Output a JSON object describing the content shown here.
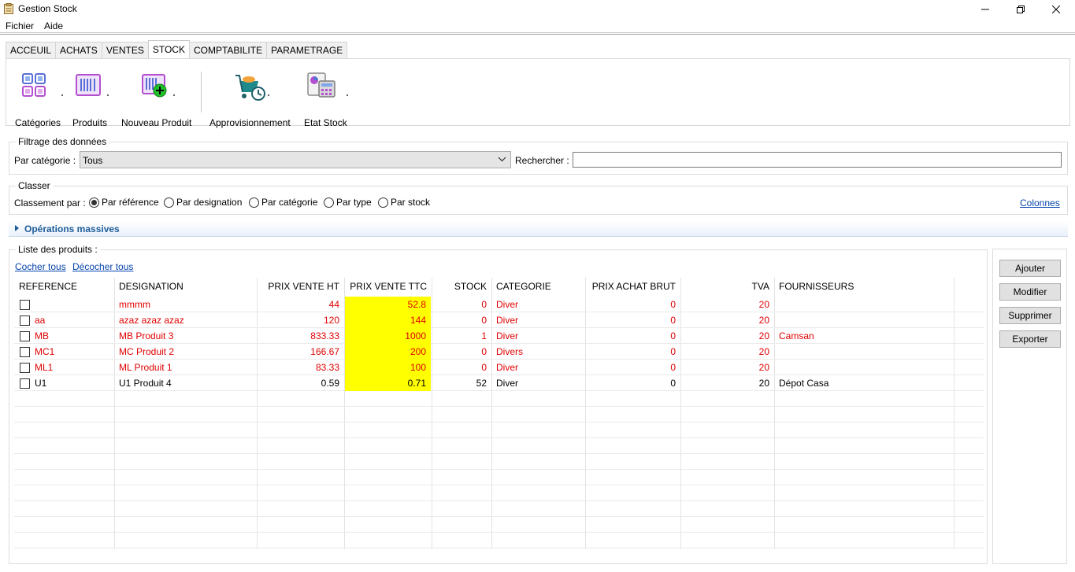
{
  "window": {
    "title": "Gestion Stock"
  },
  "menu": [
    "Fichier",
    "Aide"
  ],
  "tabs": [
    "ACCEUIL",
    "ACHATS",
    "VENTES",
    "STOCK",
    "COMPTABILITE",
    "PARAMETRAGE"
  ],
  "active_tab": "STOCK",
  "ribbon": {
    "categories": "Catégories",
    "produits": "Produits",
    "nouveau_produit": "Nouveau Produit",
    "approvisionnement": "Approvisionnement",
    "etat_stock": "Etat Stock"
  },
  "filter": {
    "group_title": "Filtrage des données",
    "category_label": "Par catégorie :",
    "category_value": "Tous",
    "search_label": "Rechercher :",
    "search_value": ""
  },
  "sort": {
    "group_title": "Classer",
    "label": "Classement par :",
    "options": [
      "Par référence",
      "Par designation",
      "Par catégorie",
      "Par type",
      "Par stock"
    ],
    "selected": "Par référence",
    "columns_link": "Colonnes"
  },
  "massive": {
    "label": "Opérations massives"
  },
  "list": {
    "group_title": "Liste des produits :",
    "check_all": "Cocher tous",
    "uncheck_all": "Décocher tous",
    "headers": [
      "REFERENCE",
      "DESIGNATION",
      "PRIX VENTE HT",
      "PRIX VENTE TTC",
      "STOCK",
      "CATEGORIE",
      "PRIX ACHAT BRUT",
      "TVA",
      "FOURNISSEURS"
    ],
    "rows": [
      {
        "ref": "",
        "designation": "mmmm",
        "pvht": "44",
        "pvttc": "52.8",
        "stock": "0",
        "categorie": "Diver",
        "achat": "0",
        "tva": "20",
        "fournisseur": "",
        "alert": true
      },
      {
        "ref": "aa",
        "designation": "azaz azaz azaz",
        "pvht": "120",
        "pvttc": "144",
        "stock": "0",
        "categorie": "Diver",
        "achat": "0",
        "tva": "20",
        "fournisseur": "",
        "alert": true
      },
      {
        "ref": "MB",
        "designation": "MB Produit 3",
        "pvht": "833.33",
        "pvttc": "1000",
        "stock": "1",
        "categorie": "Diver",
        "achat": "0",
        "tva": "20",
        "fournisseur": "Camsan",
        "alert": true
      },
      {
        "ref": "MC1",
        "designation": "MC Produit 2",
        "pvht": "166.67",
        "pvttc": "200",
        "stock": "0",
        "categorie": "Divers",
        "achat": "0",
        "tva": "20",
        "fournisseur": "",
        "alert": true
      },
      {
        "ref": "ML1",
        "designation": "ML Produit 1",
        "pvht": "83.33",
        "pvttc": "100",
        "stock": "0",
        "categorie": "Diver",
        "achat": "0",
        "tva": "20",
        "fournisseur": "",
        "alert": true
      },
      {
        "ref": "U1",
        "designation": "U1 Produit 4",
        "pvht": "0.59",
        "pvttc": "0.71",
        "stock": "52",
        "categorie": "Diver",
        "achat": "0",
        "tva": "20",
        "fournisseur": "Dépot Casa",
        "alert": false
      }
    ]
  },
  "actions": [
    "Ajouter",
    "Modifier",
    "Supprimer",
    "Exporter"
  ],
  "colors": {
    "alert_text": "#e00000",
    "ttc_highlight": "#ffff00",
    "link": "#0645ad"
  }
}
